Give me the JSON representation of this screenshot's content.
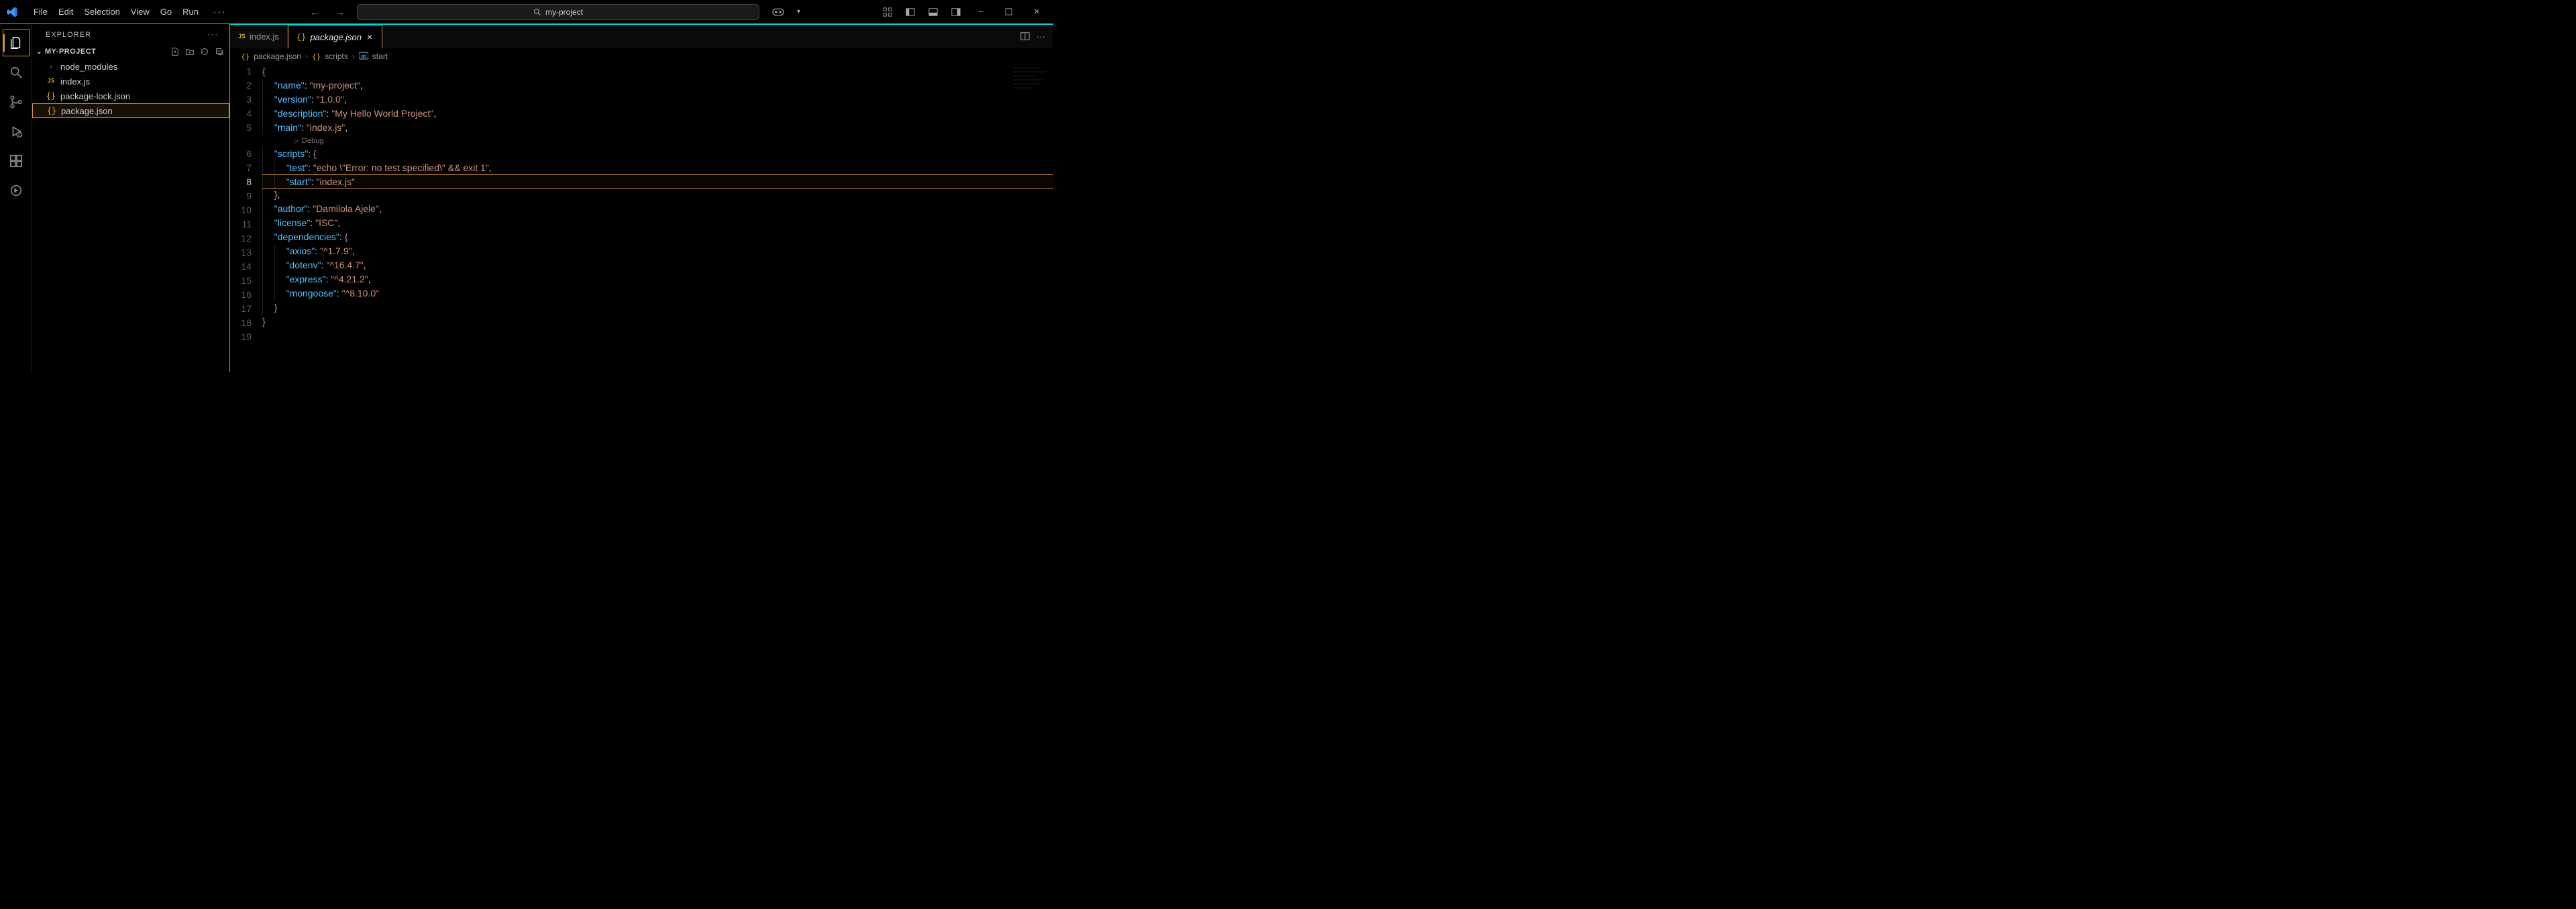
{
  "titlebar": {
    "menus": [
      "File",
      "Edit",
      "Selection",
      "View",
      "Go",
      "Run"
    ],
    "more": "···",
    "search_text": "my-project"
  },
  "activity_bar": {
    "items": [
      "files",
      "search",
      "scm",
      "debug",
      "extensions",
      "cycle"
    ]
  },
  "sidebar": {
    "title": "EXPLORER",
    "actions": "···",
    "project_name": "MY-PROJECT",
    "tree": [
      {
        "type": "folder",
        "label": "node_modules"
      },
      {
        "type": "js",
        "label": "index.js"
      },
      {
        "type": "json",
        "label": "package-lock.json"
      },
      {
        "type": "json",
        "label": "package.json",
        "selected": true
      }
    ]
  },
  "editor": {
    "tabs": [
      {
        "icon": "js",
        "label": "index.js",
        "active": false
      },
      {
        "icon": "json",
        "label": "package.json",
        "active": true
      }
    ],
    "breadcrumb": [
      {
        "icon": "{}",
        "label": "package.json"
      },
      {
        "icon": "{}",
        "label": "scripts"
      },
      {
        "icon": "abc",
        "label": "start"
      }
    ],
    "highlight_line": 8,
    "codelens_after_line": 5,
    "codelens_text": "Debug",
    "file_json": {
      "name": "my-project",
      "version": "1.0.0",
      "description": "My Hello World Project",
      "main": "index.js",
      "scripts": {
        "test": "echo \\\"Error: no test specified\\\" && exit 1",
        "start": "index.js"
      },
      "author": "Damilola Ajele",
      "license": "ISC",
      "dependencies": {
        "axios": "^1.7.9",
        "dotenv": "^16.4.7",
        "express": "^4.21.2",
        "mongoose": "^8.10.0"
      }
    },
    "lines": [
      {
        "n": 1,
        "indent": 0,
        "tokens": [
          [
            "s-brace",
            "{"
          ]
        ]
      },
      {
        "n": 2,
        "indent": 1,
        "tokens": [
          [
            "s-key",
            "\"name\""
          ],
          [
            "s-colon",
            ": "
          ],
          [
            "s-str",
            "\"my-project\""
          ],
          [
            "s-comma",
            ","
          ]
        ]
      },
      {
        "n": 3,
        "indent": 1,
        "tokens": [
          [
            "s-key",
            "\"version\""
          ],
          [
            "s-colon",
            ": "
          ],
          [
            "s-str",
            "\"1.0.0\""
          ],
          [
            "s-comma",
            ","
          ]
        ]
      },
      {
        "n": 4,
        "indent": 1,
        "tokens": [
          [
            "s-key",
            "\"description\""
          ],
          [
            "s-colon",
            ": "
          ],
          [
            "s-str",
            "\"My Hello World Project\""
          ],
          [
            "s-comma",
            ","
          ]
        ]
      },
      {
        "n": 5,
        "indent": 1,
        "tokens": [
          [
            "s-key",
            "\"main\""
          ],
          [
            "s-colon",
            ": "
          ],
          [
            "s-str",
            "\"index.js\""
          ],
          [
            "s-comma",
            ","
          ]
        ]
      },
      {
        "n": 6,
        "indent": 1,
        "tokens": [
          [
            "s-key",
            "\"scripts\""
          ],
          [
            "s-colon",
            ": "
          ],
          [
            "s-brace",
            "{"
          ]
        ]
      },
      {
        "n": 7,
        "indent": 2,
        "tokens": [
          [
            "s-key",
            "\"test\""
          ],
          [
            "s-colon",
            ": "
          ],
          [
            "s-str",
            "\"echo \\\"Error: no test specified\\\" && exit 1\""
          ],
          [
            "s-comma",
            ","
          ]
        ]
      },
      {
        "n": 8,
        "indent": 2,
        "tokens": [
          [
            "s-key",
            "\"start\""
          ],
          [
            "s-colon",
            ": "
          ],
          [
            "s-str",
            "\"index.js\""
          ]
        ]
      },
      {
        "n": 9,
        "indent": 1,
        "tokens": [
          [
            "s-brace",
            "}"
          ],
          [
            "s-comma",
            ","
          ]
        ]
      },
      {
        "n": 10,
        "indent": 1,
        "tokens": [
          [
            "s-key",
            "\"author\""
          ],
          [
            "s-colon",
            ": "
          ],
          [
            "s-str",
            "\"Damilola Ajele\""
          ],
          [
            "s-comma",
            ","
          ]
        ]
      },
      {
        "n": 11,
        "indent": 1,
        "tokens": [
          [
            "s-key",
            "\"license\""
          ],
          [
            "s-colon",
            ": "
          ],
          [
            "s-str",
            "\"ISC\""
          ],
          [
            "s-comma",
            ","
          ]
        ]
      },
      {
        "n": 12,
        "indent": 1,
        "tokens": [
          [
            "s-key",
            "\"dependencies\""
          ],
          [
            "s-colon",
            ": "
          ],
          [
            "s-brace",
            "{"
          ]
        ]
      },
      {
        "n": 13,
        "indent": 2,
        "tokens": [
          [
            "s-key",
            "\"axios\""
          ],
          [
            "s-colon",
            ": "
          ],
          [
            "s-str",
            "\"^1.7.9\""
          ],
          [
            "s-comma",
            ","
          ]
        ]
      },
      {
        "n": 14,
        "indent": 2,
        "tokens": [
          [
            "s-key",
            "\"dotenv\""
          ],
          [
            "s-colon",
            ": "
          ],
          [
            "s-str",
            "\"^16.4.7\""
          ],
          [
            "s-comma",
            ","
          ]
        ]
      },
      {
        "n": 15,
        "indent": 2,
        "tokens": [
          [
            "s-key",
            "\"express\""
          ],
          [
            "s-colon",
            ": "
          ],
          [
            "s-str",
            "\"^4.21.2\""
          ],
          [
            "s-comma",
            ","
          ]
        ]
      },
      {
        "n": 16,
        "indent": 2,
        "tokens": [
          [
            "s-key",
            "\"mongoose\""
          ],
          [
            "s-colon",
            ": "
          ],
          [
            "s-str",
            "\"^8.10.0\""
          ]
        ]
      },
      {
        "n": 17,
        "indent": 1,
        "tokens": [
          [
            "s-brace",
            "}"
          ]
        ]
      },
      {
        "n": 18,
        "indent": 0,
        "tokens": [
          [
            "s-brace",
            "}"
          ]
        ]
      },
      {
        "n": 19,
        "indent": 0,
        "tokens": []
      }
    ]
  }
}
